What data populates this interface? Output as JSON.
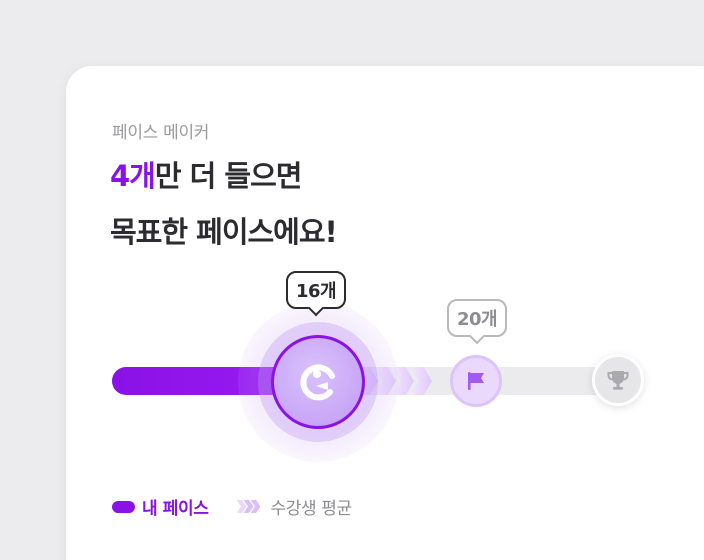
{
  "header": {
    "eyebrow": "페이스 메이커",
    "headline_count": "4개",
    "headline_rest": "만 더 들으면",
    "headline_line2": "목표한 페이스에요!"
  },
  "progress": {
    "my_label": "16개",
    "average_label": "20개",
    "my_icon": "pacman-face-icon",
    "average_icon": "flag-icon",
    "goal_icon": "trophy-icon"
  },
  "legend": {
    "mine": "내 페이스",
    "average": "수강생 평균"
  },
  "colors": {
    "accent": "#8a12e6",
    "accent_light": "#d9c0fb",
    "track": "#ebebee",
    "text_primary": "#2b2b30",
    "text_secondary": "#8c8c92"
  }
}
